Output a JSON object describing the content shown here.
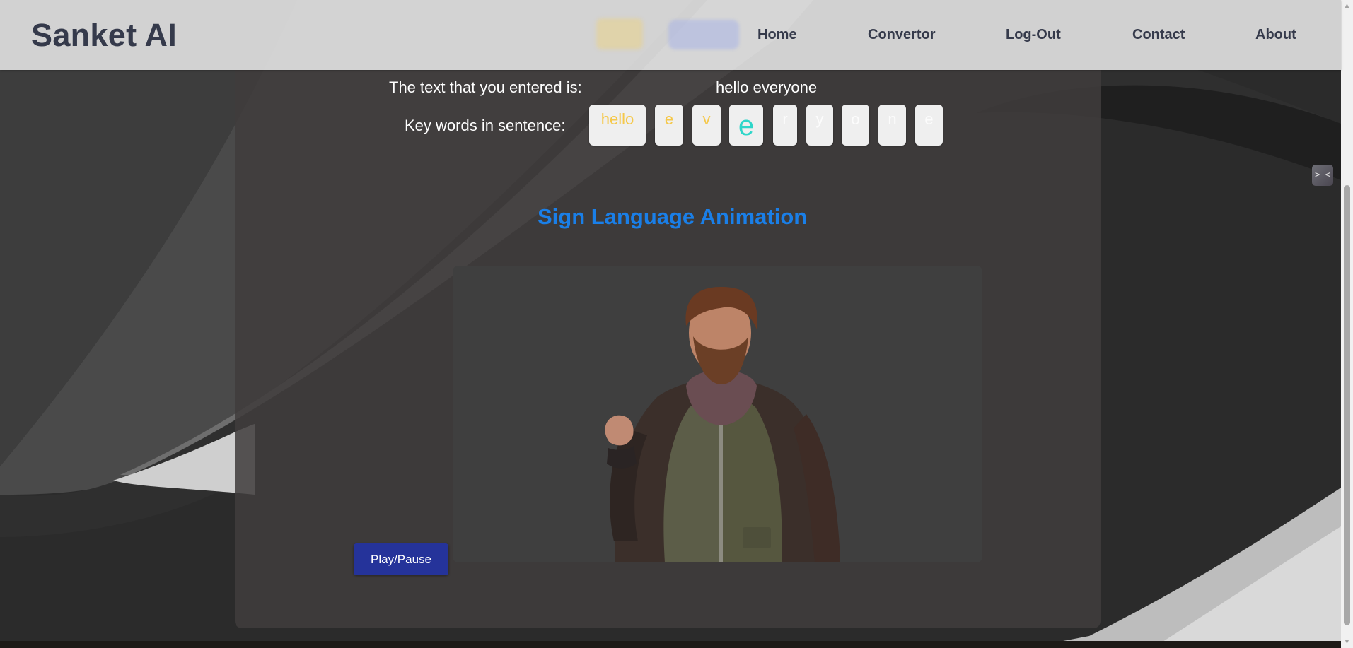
{
  "app": {
    "logo": "Sanket AI"
  },
  "nav": {
    "items": [
      "Home",
      "Convertor",
      "Log-Out",
      "Contact",
      "About"
    ]
  },
  "result": {
    "entered_label": "The text that you entered is:",
    "entered_text": "hello everyone",
    "keywords_label": "Key words in sentence:",
    "keywords": [
      "hello",
      "e",
      "v",
      "e",
      "r",
      "y",
      "o",
      "n",
      "e"
    ],
    "keyword_states": [
      "done",
      "done",
      "done",
      "active",
      "pending",
      "pending",
      "pending",
      "pending",
      "pending"
    ]
  },
  "animation": {
    "title": "Sign Language Animation",
    "play_label": "Play/Pause"
  },
  "extension": {
    "icon_text": ">_<"
  },
  "colors": {
    "accent_title": "#1a7fe8",
    "play_button": "#25339a",
    "keyword_done": "#f5c84a",
    "keyword_active": "#2fd6c9"
  },
  "icons": {
    "scroll_up": "scroll-up-arrow-icon",
    "scroll_down": "scroll-down-arrow-icon",
    "extension": "extension-icon"
  }
}
